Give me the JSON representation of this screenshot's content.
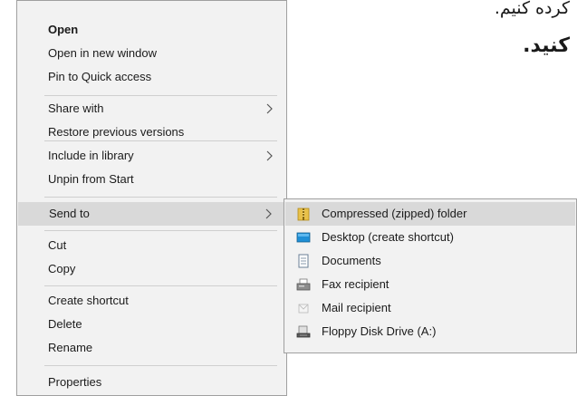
{
  "background_text": {
    "line1": "کرده کنیم.",
    "line2": "کنید."
  },
  "context_menu": {
    "items": [
      {
        "label": "Open",
        "bold": true
      },
      {
        "label": "Open in new window"
      },
      {
        "label": "Pin to Quick access"
      },
      {
        "label": "Share with",
        "has_submenu": true
      },
      {
        "label": "Restore previous versions"
      },
      {
        "label": "Include in library",
        "has_submenu": true
      },
      {
        "label": "Unpin from Start"
      },
      {
        "label": "Send to",
        "has_submenu": true,
        "highlighted": true
      },
      {
        "label": "Cut"
      },
      {
        "label": "Copy"
      },
      {
        "label": "Create shortcut"
      },
      {
        "label": "Delete"
      },
      {
        "label": "Rename"
      },
      {
        "label": "Properties"
      }
    ]
  },
  "send_to_submenu": {
    "items": [
      {
        "label": "Compressed (zipped) folder",
        "icon": "zip-folder-icon",
        "highlighted": true
      },
      {
        "label": "Desktop (create shortcut)",
        "icon": "desktop-icon"
      },
      {
        "label": "Documents",
        "icon": "documents-icon"
      },
      {
        "label": "Fax recipient",
        "icon": "fax-icon"
      },
      {
        "label": "Mail recipient",
        "icon": "mail-icon"
      },
      {
        "label": "Floppy Disk Drive (A:)",
        "icon": "floppy-drive-icon"
      }
    ]
  },
  "colors": {
    "menu_background": "#f2f2f2",
    "highlight": "#d9d9d9",
    "border": "#a0a0a0",
    "separator": "#cfcfcf"
  }
}
